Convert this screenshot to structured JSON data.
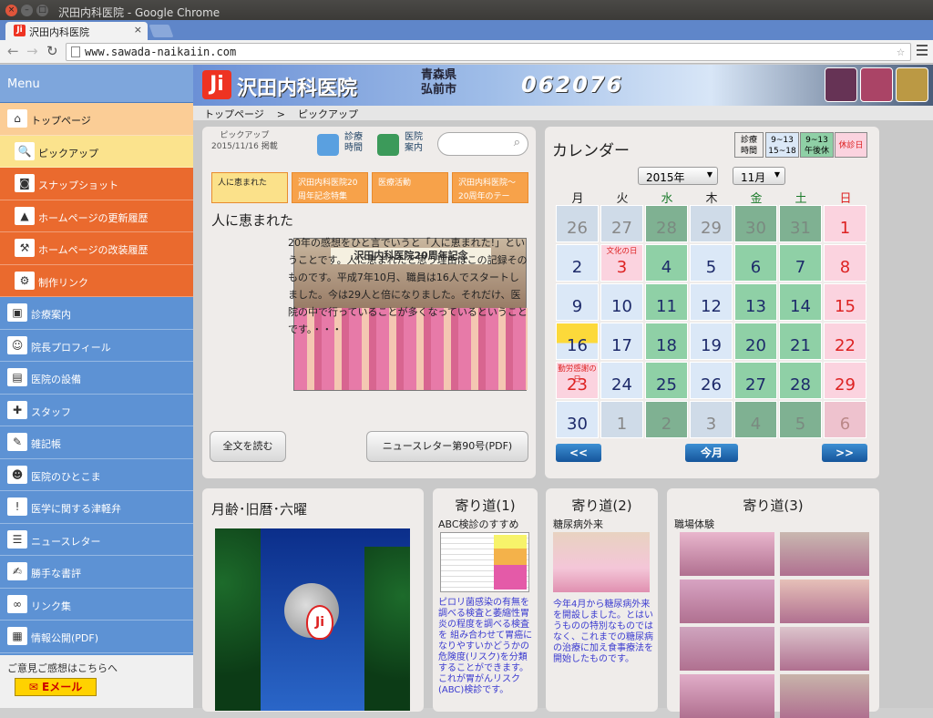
{
  "browser": {
    "window_title": "沢田内科医院 - Google Chrome",
    "tab_title": "沢田内科医院",
    "url": "www.sawada-naikaiin.com"
  },
  "sidebar": {
    "menu_title": "Menu",
    "items": [
      {
        "label": "トップページ",
        "icon": "home-icon",
        "glyph": "⌂"
      },
      {
        "label": "ピックアップ",
        "icon": "magnifier-icon",
        "glyph": "🔍"
      },
      {
        "label": "スナップショット",
        "icon": "camera-icon",
        "glyph": "◙"
      },
      {
        "label": "ホームページの更新履歴",
        "icon": "stamp-icon",
        "glyph": "▲"
      },
      {
        "label": "ホームページの改装履歴",
        "icon": "hammer-icon",
        "glyph": "⚒"
      },
      {
        "label": "制作リンク",
        "icon": "gear-icon",
        "glyph": "⚙"
      },
      {
        "label": "診療案内",
        "icon": "clinic-icon",
        "glyph": "▣"
      },
      {
        "label": "院長プロフィール",
        "icon": "doctor-icon",
        "glyph": "☺"
      },
      {
        "label": "医院の設備",
        "icon": "equipment-icon",
        "glyph": "▤"
      },
      {
        "label": "スタッフ",
        "icon": "nurse-cap-icon",
        "glyph": "✚"
      },
      {
        "label": "雑記帳",
        "icon": "notebook-icon",
        "glyph": "✎"
      },
      {
        "label": "医院のひとこま",
        "icon": "person-icon",
        "glyph": "☻"
      },
      {
        "label": "医学に関する津軽弁",
        "icon": "exclamation-icon",
        "glyph": "!"
      },
      {
        "label": "ニュースレター",
        "icon": "newsletter-icon",
        "glyph": "☰"
      },
      {
        "label": "勝手な書評",
        "icon": "book-icon",
        "glyph": "✍"
      },
      {
        "label": "リンク集",
        "icon": "handshake-icon",
        "glyph": "∞"
      },
      {
        "label": "情報公開(PDF)",
        "icon": "document-icon",
        "glyph": "▦"
      }
    ],
    "opinion_text": "ご意見ご感想はこちらへ",
    "email_button": "Eメール"
  },
  "banner": {
    "clinic_name": "沢田内科医院",
    "prefecture": "青森県",
    "city": "弘前市",
    "code": "062076"
  },
  "breadcrumb": {
    "home": "トップページ",
    "separator": ">",
    "current": "ピックアップ"
  },
  "pickup": {
    "label": "ピックアップ",
    "date": "2015/11/16 掲載",
    "btn_hours_line1": "診療",
    "btn_hours_line2": "時間",
    "btn_guide_line1": "医院",
    "btn_guide_line2": "案内",
    "tabs": [
      "人に恵まれた",
      "沢田内科医院20周年記念特集",
      "医療活動",
      "沢田内科医院～20周年のテー"
    ],
    "article_title": "人に恵まれた",
    "article_text": "20年の感想をひと言でいうと「人に恵まれた!」ということです。人に恵まれたと思う理由はこの記録そのものです。平成7年10月、職員は16人でスタートしました。今は29人と倍になりました。それだけ、医院の中で行っていることが多くなっているということです。・・・",
    "photo_banner": "沢田内科医院20周年記念",
    "read_more": "全文を読む",
    "newsletter_btn": "ニュースレター第90号(PDF)"
  },
  "calendar": {
    "title": "カレンダー",
    "legend": [
      {
        "line1": "診療",
        "line2": "時間",
        "color": "#efecea"
      },
      {
        "line1": "9~13",
        "line2": "15~18",
        "color": "#dbe8f7"
      },
      {
        "line1": "9~13",
        "line2": "午後休",
        "color": "#8fd0a6"
      },
      {
        "line1": "休診日",
        "line2": "",
        "color": "#fbd3df"
      }
    ],
    "year": "2015年",
    "month": "11月",
    "weekdays": [
      "月",
      "火",
      "水",
      "木",
      "金",
      "土",
      "日"
    ],
    "weekday_colors": [
      "#222",
      "#222",
      "#1a7a2a",
      "#222",
      "#1a7a2a",
      "#1a7a2a",
      "#d22"
    ],
    "weeks": [
      [
        {
          "d": "26",
          "t": "pb"
        },
        {
          "d": "27",
          "t": "pb"
        },
        {
          "d": "28",
          "t": "pg"
        },
        {
          "d": "29",
          "t": "pb"
        },
        {
          "d": "30",
          "t": "pg"
        },
        {
          "d": "31",
          "t": "pg"
        },
        {
          "d": "1",
          "t": "r"
        }
      ],
      [
        {
          "d": "2",
          "t": "b"
        },
        {
          "d": "3",
          "t": "r",
          "note": "文化の日"
        },
        {
          "d": "4",
          "t": "g"
        },
        {
          "d": "5",
          "t": "b"
        },
        {
          "d": "6",
          "t": "g"
        },
        {
          "d": "7",
          "t": "g"
        },
        {
          "d": "8",
          "t": "r"
        }
      ],
      [
        {
          "d": "9",
          "t": "b"
        },
        {
          "d": "10",
          "t": "b"
        },
        {
          "d": "11",
          "t": "g"
        },
        {
          "d": "12",
          "t": "b"
        },
        {
          "d": "13",
          "t": "g"
        },
        {
          "d": "14",
          "t": "g"
        },
        {
          "d": "15",
          "t": "r"
        }
      ],
      [
        {
          "d": "16",
          "t": "today"
        },
        {
          "d": "17",
          "t": "b"
        },
        {
          "d": "18",
          "t": "g"
        },
        {
          "d": "19",
          "t": "b"
        },
        {
          "d": "20",
          "t": "g"
        },
        {
          "d": "21",
          "t": "g"
        },
        {
          "d": "22",
          "t": "r"
        }
      ],
      [
        {
          "d": "23",
          "t": "r",
          "note": "勤労感謝の日"
        },
        {
          "d": "24",
          "t": "b"
        },
        {
          "d": "25",
          "t": "g"
        },
        {
          "d": "26",
          "t": "b"
        },
        {
          "d": "27",
          "t": "g"
        },
        {
          "d": "28",
          "t": "g"
        },
        {
          "d": "29",
          "t": "r"
        }
      ],
      [
        {
          "d": "30",
          "t": "b"
        },
        {
          "d": "1",
          "t": "pb"
        },
        {
          "d": "2",
          "t": "pg"
        },
        {
          "d": "3",
          "t": "pb"
        },
        {
          "d": "4",
          "t": "pg"
        },
        {
          "d": "5",
          "t": "pg"
        },
        {
          "d": "6",
          "t": "pr"
        }
      ]
    ],
    "prev": "<<",
    "current": "今月",
    "next": ">>"
  },
  "moon": {
    "title": "月齢･旧暦･六曜"
  },
  "yorimichi1": {
    "title": "寄り道(1)",
    "subtitle": "ABC検診のすすめ",
    "text": "ピロリ菌感染の有無を調べる検査と萎縮性胃炎の程度を調べる検査を 組み合わせて胃癌になりやすいかどうかの危険度(リスク)を分類することができます。これが胃がんリスク(ABC)検診です。"
  },
  "yorimichi2": {
    "title": "寄り道(2)",
    "subtitle": "糖尿病外来",
    "text": "今年4月から糖尿病外来を開設しました。とはいうものの特別なものではなく、これまでの糖尿病の治療に加え食事療法を開始したものです。"
  },
  "yorimichi3": {
    "title": "寄り道(3)",
    "subtitle": "職場体験"
  }
}
